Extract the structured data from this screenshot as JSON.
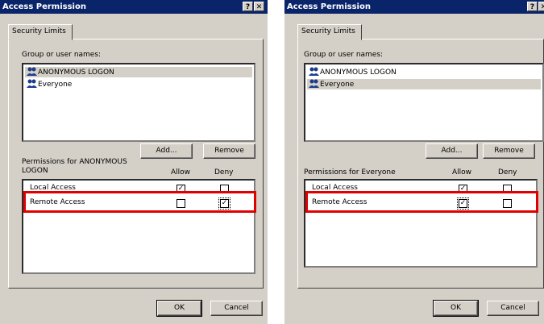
{
  "dialogs": [
    {
      "title": "Access Permission",
      "title_buttons": [
        "?",
        "✕"
      ],
      "tab": "Security Limits",
      "group_label": "Group or user names:",
      "users": [
        "ANONYMOUS LOGON",
        "Everyone"
      ],
      "selected_user": "ANONYMOUS LOGON",
      "add_label": "Add...",
      "remove_label": "Remove",
      "permissions_label": "Permissions for ANONYMOUS LOGON",
      "allow_header": "Allow",
      "deny_header": "Deny",
      "permissions": [
        {
          "name": "Local Access",
          "allow": true,
          "deny": false
        },
        {
          "name": "Remote Access",
          "allow": false,
          "deny": true
        }
      ],
      "highlighted_permission": "Remote Access",
      "ok_label": "OK",
      "cancel_label": "Cancel"
    },
    {
      "title": "Access Permission",
      "title_buttons": [
        "?",
        "✕"
      ],
      "tab": "Security Limits",
      "group_label": "Group or user names:",
      "users": [
        "ANONYMOUS LOGON",
        "Everyone"
      ],
      "selected_user": "Everyone",
      "add_label": "Add...",
      "remove_label": "Remove",
      "permissions_label": "Permissions for Everyone",
      "allow_header": "Allow",
      "deny_header": "Deny",
      "permissions": [
        {
          "name": "Local Access",
          "allow": true,
          "deny": false
        },
        {
          "name": "Remote Access",
          "allow": true,
          "deny": false
        }
      ],
      "highlighted_permission": "Remote Access",
      "ok_label": "OK",
      "cancel_label": "Cancel"
    }
  ],
  "colors": {
    "titlebar": "#0a246a",
    "face": "#d4d0c8",
    "highlight": "#e00000"
  }
}
